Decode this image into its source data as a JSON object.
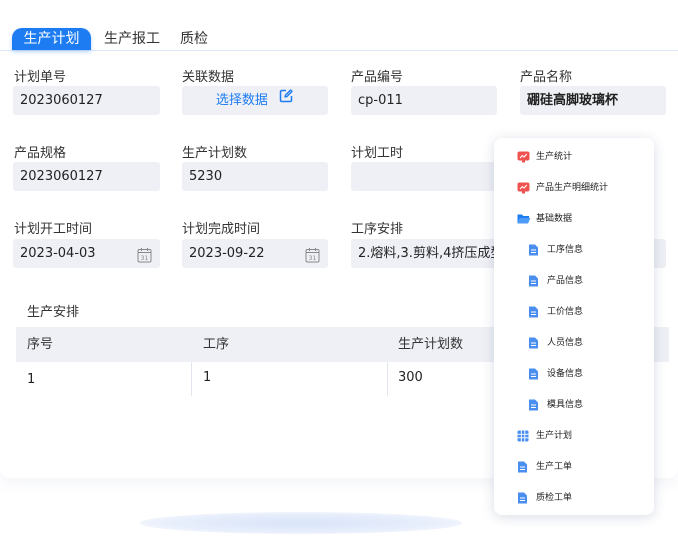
{
  "tabs": [
    {
      "label": "生产计划",
      "active": true
    },
    {
      "label": "生产报工",
      "active": false
    },
    {
      "label": "质检",
      "active": false
    }
  ],
  "form": {
    "plan_no": {
      "label": "计划单号",
      "value": "2023060127"
    },
    "related": {
      "label": "关联数据",
      "button": "选择数据"
    },
    "product_code": {
      "label": "产品编号",
      "value": "cp-011"
    },
    "product_name": {
      "label": "产品名称",
      "value": "硼硅高脚玻璃杯"
    },
    "spec": {
      "label": "产品规格",
      "value": "2023060127"
    },
    "plan_qty": {
      "label": "生产计划数",
      "value": "5230"
    },
    "plan_hours": {
      "label": "计划工时",
      "value": ""
    },
    "start_time": {
      "label": "计划开工时间",
      "value": "2023-04-03"
    },
    "end_time": {
      "label": "计划完成时间",
      "value": "2023-09-22"
    },
    "process": {
      "label": "工序安排",
      "value": "2.熔料,3.剪料,4挤压成型"
    }
  },
  "schedule": {
    "title": "生产安排",
    "columns": [
      "序号",
      "工序",
      "生产计划数"
    ],
    "rows": [
      [
        "1",
        "1",
        "300"
      ]
    ]
  },
  "menu": {
    "items": [
      {
        "label": "生产统计",
        "icon": "chart-icon"
      },
      {
        "label": "产品生产明细统计",
        "icon": "chart-icon"
      },
      {
        "label": "基础数据",
        "icon": "folder-open-icon"
      },
      {
        "label": "工序信息",
        "icon": "document-icon"
      },
      {
        "label": "产品信息",
        "icon": "document-icon"
      },
      {
        "label": "工价信息",
        "icon": "document-icon"
      },
      {
        "label": "人员信息",
        "icon": "document-icon"
      },
      {
        "label": "设备信息",
        "icon": "document-icon"
      },
      {
        "label": "模具信息",
        "icon": "document-icon"
      },
      {
        "label": "生产计划",
        "icon": "table-icon"
      },
      {
        "label": "生产工单",
        "icon": "document-icon"
      },
      {
        "label": "质检工单",
        "icon": "document-icon"
      }
    ]
  },
  "colors": {
    "accent": "#1e7cf2",
    "field_bg": "#eef0f5",
    "chart_icon": "#ef5350"
  }
}
